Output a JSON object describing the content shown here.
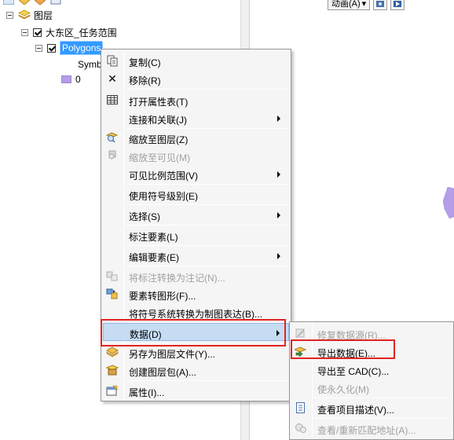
{
  "toc": {
    "root_label": "图层",
    "group_label": "大东区_任务范围",
    "layer_label": "Polygons",
    "symbol_label": "Symb",
    "class_value": "0"
  },
  "map_toolbar": {
    "animation_label": "动画(A)",
    "animation_arrow": "▾"
  },
  "context_menu": {
    "items": [
      {
        "label": "复制(C)",
        "icon": "copy-icon",
        "enabled": true
      },
      {
        "label": "移除(R)",
        "icon": "remove-icon",
        "enabled": true
      },
      {
        "label": "打开属性表(T)",
        "icon": "table-icon",
        "enabled": true
      },
      {
        "label": "连接和关联(J)",
        "icon": "",
        "enabled": true,
        "submenu": true
      },
      {
        "label": "缩放至图层(Z)",
        "icon": "zoom-to-layer-icon",
        "enabled": true
      },
      {
        "label": "缩放至可见(M)",
        "icon": "zoom-to-visible-icon",
        "enabled": false
      },
      {
        "label": "可见比例范围(V)",
        "icon": "",
        "enabled": true,
        "submenu": true
      },
      {
        "label": "使用符号级别(E)",
        "icon": "",
        "enabled": true
      },
      {
        "label": "选择(S)",
        "icon": "",
        "enabled": true,
        "submenu": true
      },
      {
        "label": "标注要素(L)",
        "icon": "",
        "enabled": true
      },
      {
        "label": "编辑要素(E)",
        "icon": "",
        "enabled": true,
        "submenu": true
      },
      {
        "label": "将标注转换为注记(N)...",
        "icon": "convert-labels-icon",
        "enabled": false
      },
      {
        "label": "要素转图形(F)...",
        "icon": "features-to-graphics-icon",
        "enabled": true
      },
      {
        "label": "将符号系统转换为制图表达(B)...",
        "icon": "",
        "enabled": true
      },
      {
        "label": "数据(D)",
        "icon": "",
        "enabled": true,
        "submenu": true,
        "highlighted": true
      },
      {
        "label": "另存为图层文件(Y)...",
        "icon": "save-layer-icon",
        "enabled": true
      },
      {
        "label": "创建图层包(A)...",
        "icon": "layer-package-icon",
        "enabled": true
      },
      {
        "label": "属性(I)...",
        "icon": "properties-icon",
        "enabled": true
      }
    ]
  },
  "data_submenu": {
    "items": [
      {
        "label": "修复数据源(R)...",
        "icon": "repair-source-icon",
        "enabled": false
      },
      {
        "label": "导出数据(E)...",
        "icon": "export-data-icon",
        "enabled": true
      },
      {
        "label": "导出至 CAD(C)...",
        "icon": "",
        "enabled": true
      },
      {
        "label": "使永久化(M)",
        "icon": "",
        "enabled": false
      },
      {
        "label": "查看项目描述(V)...",
        "icon": "item-description-icon",
        "enabled": true
      },
      {
        "label": "查看/重新匹配地址(A)...",
        "icon": "rematch-address-icon",
        "enabled": false
      }
    ]
  },
  "colors": {
    "menu_bg": "#f5f5f5",
    "hover_bg": "#c6dcf3",
    "selection_blue": "#3399ff",
    "highlight_red": "#e02424",
    "polygon_fill": "#b49ee8",
    "disabled_text": "#a0a0a0"
  }
}
